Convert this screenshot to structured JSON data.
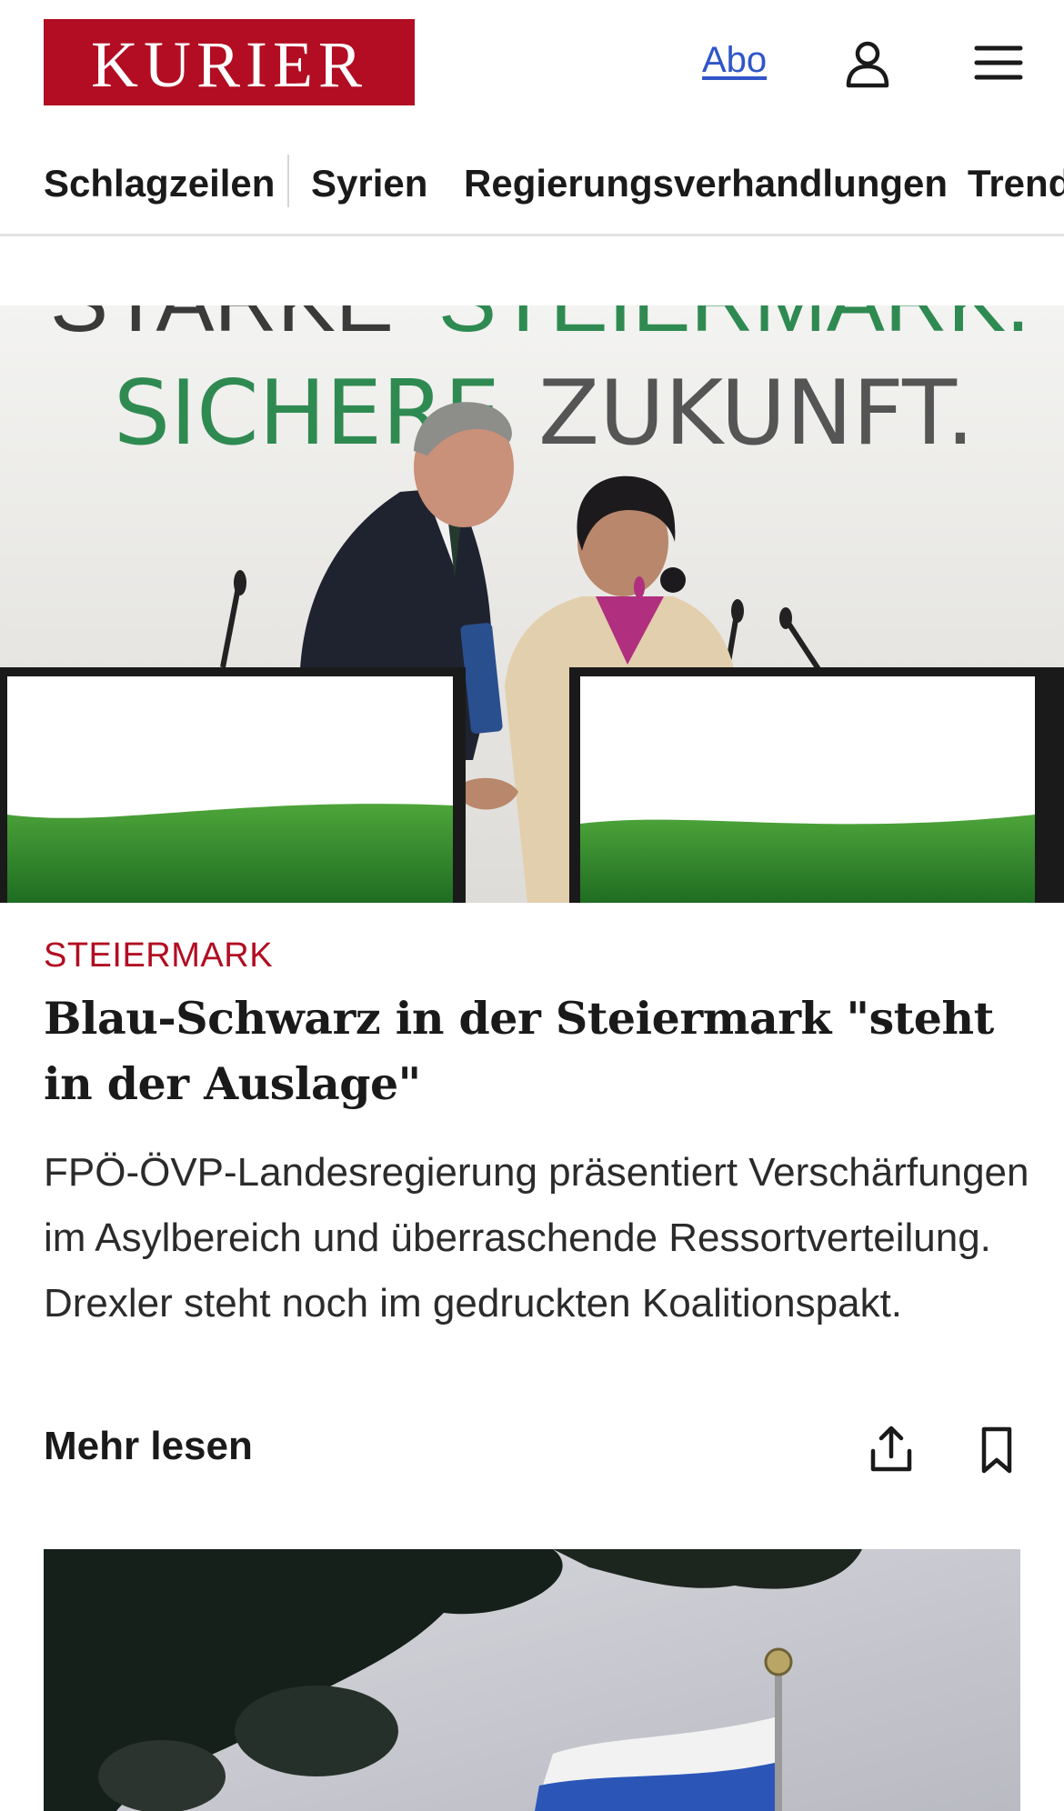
{
  "header": {
    "logo_text": "KURIER",
    "abo_label": "Abo",
    "brand_color": "#b20d22",
    "link_color": "#2f55c8",
    "icons": {
      "account": "user-icon",
      "menu": "hamburger-menu-icon"
    }
  },
  "nav": {
    "items": [
      {
        "label": "Schlagzeilen"
      },
      {
        "label": "Syrien"
      },
      {
        "label": "Regierungsverhandlungen"
      },
      {
        "label": "Trends"
      }
    ]
  },
  "hero": {
    "backdrop_line_1": "STARKE STEIERMARK.",
    "backdrop_line_2_green": "SICHERE",
    "backdrop_line_2_grey": "ZUKUNFT."
  },
  "article": {
    "kicker": "STEIERMARK",
    "headline": "Blau-Schwarz in der Steiermark \"steht in der Auslage\"",
    "teaser": "FPÖ-ÖVP-Landesregierung präsentiert Verschärfungen im Asylbereich und überraschende Ressortverteilung. Drexler steht noch im gedruckten Koalitionspakt.",
    "more_label": "Mehr lesen",
    "icons": {
      "share": "share-icon",
      "bookmark": "bookmark-icon"
    }
  }
}
